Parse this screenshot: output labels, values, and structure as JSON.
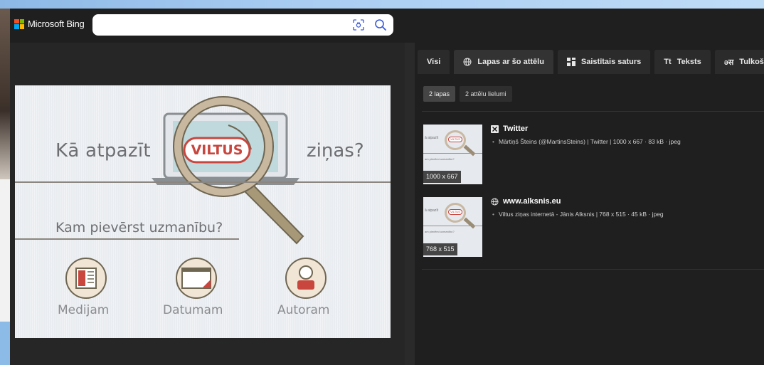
{
  "header": {
    "logo_text": "Microsoft Bing",
    "search_value": "",
    "search_placeholder": ""
  },
  "preview": {
    "title_left": "Kā atpazīt",
    "badge": "VILTUS",
    "title_right": "ziņas?",
    "subtitle": "Kam pievērst uzmanību?",
    "labels": [
      "Medijam",
      "Datumam",
      "Autoram"
    ]
  },
  "tabs": [
    {
      "label": "Visi",
      "icon": "none",
      "active": false
    },
    {
      "label": "Lapas ar šo attēlu",
      "icon": "globe-icon",
      "active": true
    },
    {
      "label": "Saistītais saturs",
      "icon": "grid-icon",
      "active": false
    },
    {
      "label": "Teksts",
      "icon": "text-icon",
      "active": false
    },
    {
      "label": "Tulkošana",
      "icon": "translate-icon",
      "active": false
    }
  ],
  "tab_icons": {
    "text": "Tt",
    "translate": "əस"
  },
  "filters": [
    "2 lapas",
    "2 attēlu lielumi"
  ],
  "results": [
    {
      "site": "Twitter",
      "icon": "x-logo-icon",
      "description": "Mārtiņš Šteins (@MartinsSteins) | Twitter | 1000 x 667 · 83 kB · jpeg",
      "dimensions": "1000 x 667",
      "thumb_title": "ā atpazīt",
      "thumb_badge": "VILTUS",
      "thumb_sub": "am pievērst uzmanību?"
    },
    {
      "site": "www.alksnis.eu",
      "icon": "globe-icon",
      "description": "Viltus ziņas internetā - Jānis Alksnis | 768 x 515 · 45 kB · jpeg",
      "dimensions": "768 x 515",
      "thumb_title": "ā atpazīt",
      "thumb_badge": "VILTUS",
      "thumb_sub": "am pievērst uzmanību?"
    }
  ],
  "colors": {
    "accent_red": "#c8463e",
    "background": "#1f1f1f",
    "tab_active": "#333333"
  }
}
